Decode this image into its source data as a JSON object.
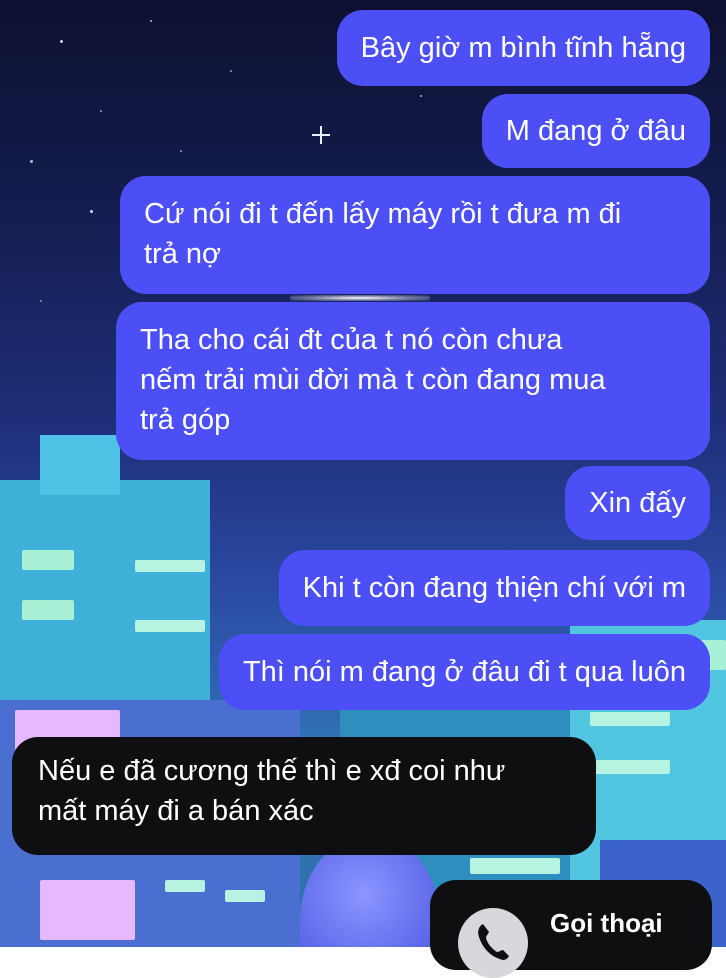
{
  "messages": [
    {
      "dir": "out",
      "text": "Bây giờ m bình tĩnh hẵng"
    },
    {
      "dir": "out",
      "text": "M đang ở đâu"
    },
    {
      "dir": "out",
      "lines": [
        "Cứ nói đi t đến lấy máy rồi t đưa m đi",
        "trả nợ"
      ]
    },
    {
      "dir": "out",
      "lines": [
        "Tha cho cái đt của t nó còn chưa",
        "nếm trải mùi đời mà t còn đang mua",
        "trả góp"
      ]
    },
    {
      "dir": "out",
      "text": "Xin đấy"
    },
    {
      "dir": "out",
      "text": "Khi t còn đang thiện chí với m"
    },
    {
      "dir": "out",
      "text": "Thì nói m đang ở đâu đi t qua luôn"
    },
    {
      "dir": "in",
      "lines": [
        "Nếu e đã cương thế thì e xđ coi như",
        "mất máy đi a bán xác"
      ]
    }
  ],
  "call": {
    "label": "Gọi thoại",
    "icon": "phone-icon"
  },
  "colors": {
    "outgoing_bubble": "#4b4ff5",
    "incoming_bubble": "#0f0f12",
    "text": "#ffffff"
  }
}
